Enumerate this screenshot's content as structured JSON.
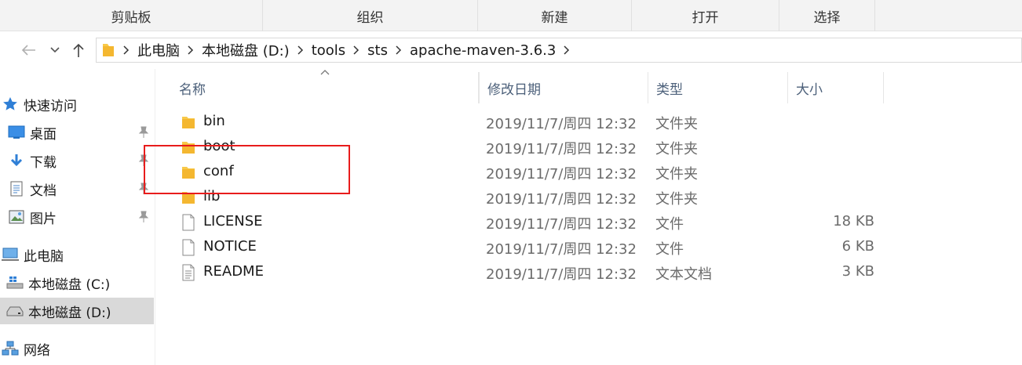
{
  "ribbon": {
    "groups": [
      "剪贴板",
      "组织",
      "新建",
      "打开",
      "选择"
    ]
  },
  "address": {
    "crumbs": [
      "此电脑",
      "本地磁盘 (D:)",
      "tools",
      "sts",
      "apache-maven-3.6.3"
    ]
  },
  "sidebar": {
    "items": [
      {
        "label": "快速访问",
        "icon": "star-icon"
      },
      {
        "label": "桌面",
        "icon": "desktop-icon"
      },
      {
        "label": "下载",
        "icon": "download-arrow-icon"
      },
      {
        "label": "文档",
        "icon": "document-icon"
      },
      {
        "label": "图片",
        "icon": "picture-icon"
      },
      {
        "label": "此电脑",
        "icon": "computer-icon"
      },
      {
        "label": "本地磁盘 (C:)",
        "icon": "windows-drive-icon"
      },
      {
        "label": "本地磁盘 (D:)",
        "icon": "drive-icon"
      },
      {
        "label": "网络",
        "icon": "network-icon"
      }
    ]
  },
  "columns": [
    "名称",
    "修改日期",
    "类型",
    "大小"
  ],
  "files": [
    {
      "name": "bin",
      "date": "2019/11/7/周四 12:32",
      "type": "文件夹",
      "size": "",
      "kind": "folder"
    },
    {
      "name": "boot",
      "date": "2019/11/7/周四 12:32",
      "type": "文件夹",
      "size": "",
      "kind": "folder"
    },
    {
      "name": "conf",
      "date": "2019/11/7/周四 12:32",
      "type": "文件夹",
      "size": "",
      "kind": "folder"
    },
    {
      "name": "lib",
      "date": "2019/11/7/周四 12:32",
      "type": "文件夹",
      "size": "",
      "kind": "folder"
    },
    {
      "name": "LICENSE",
      "date": "2019/11/7/周四 12:32",
      "type": "文件",
      "size": "18 KB",
      "kind": "file"
    },
    {
      "name": "NOTICE",
      "date": "2019/11/7/周四 12:32",
      "type": "文件",
      "size": "6 KB",
      "kind": "file"
    },
    {
      "name": "README",
      "date": "2019/11/7/周四 12:32",
      "type": "文本文档",
      "size": "3 KB",
      "kind": "text"
    }
  ],
  "colors": {
    "highlight": "#e81c1c",
    "folder": "#f8c94a",
    "selected_bg": "#d9d9d9",
    "header_text": "#4c607a"
  }
}
